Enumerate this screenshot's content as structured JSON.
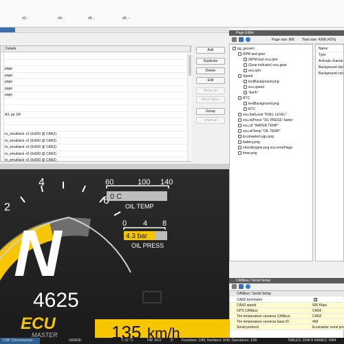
{
  "top_slots": [
    {
      "label": "#3: -"
    },
    {
      "label": "#4: -"
    },
    {
      "label": "#5: -"
    },
    {
      "label": "#6: -"
    }
  ],
  "table": {
    "col_details": "Details",
    "rows": [
      "",
      "",
      "page",
      "page",
      "page",
      "page",
      "page",
      "",
      "",
      "A3, pd 1M",
      "",
      "",
      "m_emublack +0 (0x600 @ CAN2)",
      "m_emublack +0 (0x600 @ CAN2)",
      "m_emublack +0 (0x600 @ CAN2)",
      "m_emublack +0 (0x600 @ CAN2)",
      "m_emublack +0 (0x600 @ CAN2)"
    ]
  },
  "buttons": {
    "add": "Add",
    "duplicate": "Duplicate",
    "delete": "Delete",
    "edit": "Edit",
    "move_up": "Move up",
    "move_down": "Move down",
    "group": "Group",
    "ungroup": "Ungroup"
  },
  "page_editor": {
    "title": "Page Editor",
    "page_size": "Page size: 806",
    "total_size": "Total size: 4268 (42%)",
    "tree": [
      {
        "text": "pg_gensen",
        "indent": 0
      },
      {
        "text": "RPM and gear",
        "indent": 1
      },
      {
        "text": "(RPM bar)   ecu.rpm",
        "indent": 2
      },
      {
        "text": "(Gear indicator)   ecu.gear",
        "indent": 2
      },
      {
        "text": "ecu.rpm",
        "indent": 2
      },
      {
        "text": "Speed",
        "indent": 1
      },
      {
        "text": "textBackground.png",
        "indent": 2
      },
      {
        "text": "ecu.speed",
        "indent": 2
      },
      {
        "text": "\"km/h\"",
        "indent": 2
      },
      {
        "text": "RTC",
        "indent": 1
      },
      {
        "text": "textBackground.png",
        "indent": 2
      },
      {
        "text": "RTC",
        "indent": 2
      },
      {
        "text": "ecu.fuelLevel   \"FUEL LEVEL\"",
        "indent": 1
      },
      {
        "text": "ecu.oilPress   \"OIL PRESS\"   batter",
        "indent": 1
      },
      {
        "text": "ecu.clt   \"WATER TEMP\"",
        "indent": 1
      },
      {
        "text": "ecu.oilTemp   \"OIL TEMP\"",
        "indent": 1
      },
      {
        "text": "EcumasterLogo.png",
        "indent": 1
      },
      {
        "text": "battery.png",
        "indent": 1
      },
      {
        "text": "checkEngine.png   ecu.errorFlags",
        "indent": 1
      },
      {
        "text": "timer.png",
        "indent": 1
      }
    ],
    "props": [
      "Name",
      "Type",
      "Activate channel",
      "Background style",
      "Background color"
    ]
  },
  "can": {
    "title": "CANbus / Serial Setup",
    "header": "CANbus / Serial Setup",
    "rows": [
      {
        "k": "CAN2 terminator",
        "v": "",
        "check": true
      },
      {
        "k": "CAN2 speed",
        "v": "500 Kbps"
      },
      {
        "k": "GPS CANbus",
        "v": "CAN2"
      },
      {
        "k": "Tire temperature cameras CANbus",
        "v": "CAN2"
      },
      {
        "k": "Tire temperature cameras base ID",
        "v": "468"
      },
      {
        "k": "Serial protocol",
        "v": "Ecumaster serial pro"
      }
    ]
  },
  "dash": {
    "gear": "N",
    "rpm": "4625",
    "speed": "135",
    "speed_unit": "km/h",
    "gauge_ticks": [
      "2",
      "4",
      "6"
    ],
    "oil_temp_label": "OIL TEMP",
    "oil_temp_value": "0 C",
    "oil_temp_ticks": [
      "60",
      "100",
      "140"
    ],
    "oil_press_label": "OIL PRESS",
    "oil_press_value": "4.3 bar",
    "oil_press_ticks": [
      "0",
      "4",
      "8"
    ],
    "logo_main": "ECU",
    "logo_sub": "MASTER",
    "accent": "#f7c600"
  },
  "statusbar": {
    "usb": "USB: Disconnected",
    "grade": "GRADE:",
    "t": "T:   32 °C",
    "fw": "FW: 50.0",
    "s": "5\"",
    "functions": "Functions: 1/40, Numbers: 0/40, Operations: 1/80",
    "tables": "TABLES: 2048 B  NAMES: 3484"
  }
}
